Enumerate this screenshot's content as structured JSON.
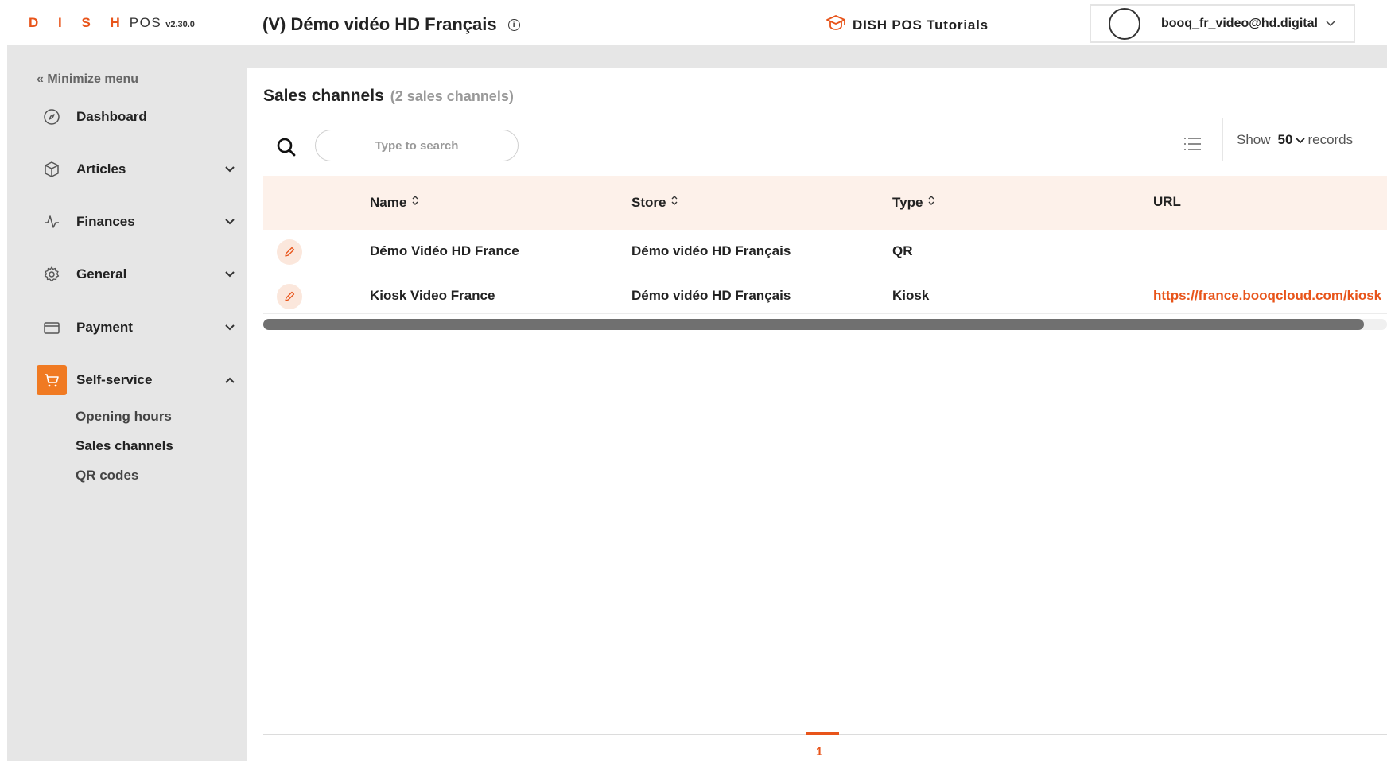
{
  "header": {
    "logo_brand": "D I S H",
    "logo_product": "POS",
    "version": "v2.30.0",
    "store_title": "(V) Démo vidéo HD Français",
    "tutorials_label": "DISH POS Tutorials",
    "user_email": "booq_fr_video@hd.digital"
  },
  "sidebar": {
    "minimize_label": "« Minimize menu",
    "items": [
      {
        "label": "Dashboard",
        "icon": "compass-icon"
      },
      {
        "label": "Articles",
        "icon": "box-icon"
      },
      {
        "label": "Finances",
        "icon": "pulse-icon"
      },
      {
        "label": "General",
        "icon": "gear-icon"
      },
      {
        "label": "Payment",
        "icon": "card-icon"
      },
      {
        "label": "Self-service",
        "icon": "cart-icon"
      }
    ],
    "sub_items": [
      "Opening hours",
      "Sales channels",
      "QR codes"
    ]
  },
  "main": {
    "title": "Sales channels",
    "count": "(2 sales channels)",
    "search_placeholder": "Type to search",
    "show_label": "Show",
    "show_value": "50",
    "records_label": "records",
    "columns": [
      "Name",
      "Store",
      "Type",
      "URL"
    ],
    "rows": [
      {
        "name": "Démo Vidéo HD France",
        "store": "Démo vidéo HD Français",
        "type": "QR",
        "url": ""
      },
      {
        "name": "Kiosk Video France",
        "store": "Démo vidéo HD Français",
        "type": "Kiosk",
        "url": "https://france.booqcloud.com/kiosk"
      }
    ],
    "page": "1"
  },
  "colors": {
    "accent": "#e8541a",
    "active_icon_bg": "#f07a22",
    "header_row_bg": "#fdf1ea",
    "sidebar_bg": "#e6e6e6"
  }
}
